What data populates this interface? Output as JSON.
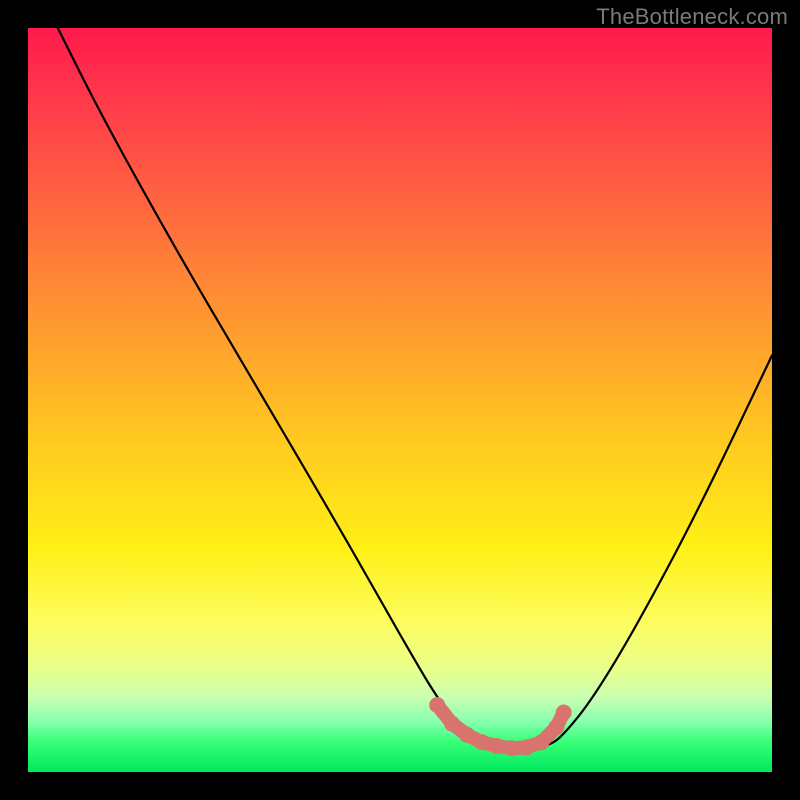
{
  "watermark": "TheBottleneck.com",
  "chart_data": {
    "type": "line",
    "title": "",
    "xlabel": "",
    "ylabel": "",
    "xlim": [
      0,
      100
    ],
    "ylim": [
      0,
      100
    ],
    "grid": false,
    "series": [
      {
        "name": "bottleneck-curve",
        "x": [
          4,
          10,
          20,
          30,
          40,
          48,
          52,
          55,
          58,
          62,
          66,
          70,
          72,
          76,
          82,
          90,
          100
        ],
        "y": [
          100,
          88,
          70,
          53,
          36,
          22,
          15,
          10,
          6,
          4,
          3,
          3.5,
          5,
          10,
          20,
          35,
          56
        ]
      }
    ],
    "markers": {
      "name": "highlight-dots",
      "color": "#d9736e",
      "x": [
        55,
        57,
        59,
        61,
        63,
        65,
        67,
        69,
        71,
        72
      ],
      "y": [
        9,
        6.5,
        5,
        4,
        3.5,
        3.2,
        3.3,
        4,
        6,
        8
      ]
    }
  }
}
